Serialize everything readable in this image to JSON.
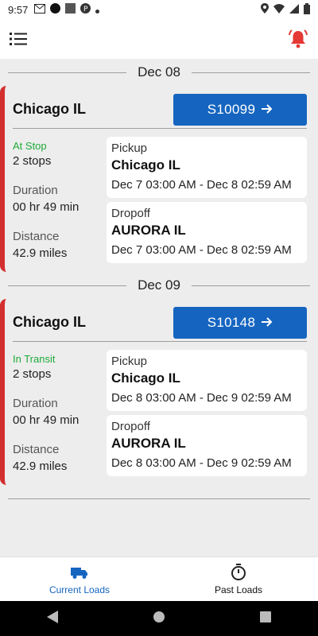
{
  "status_bar": {
    "time": "9:57"
  },
  "colors": {
    "accent": "#1565c0",
    "alert": "#d32f2f",
    "status_green": "#1faa3a"
  },
  "groups": [
    {
      "date": "Dec 08",
      "load": {
        "city": "Chicago IL",
        "load_id": "S10099",
        "status": "At Stop",
        "stops": "2 stops",
        "duration_label": "Duration",
        "duration": "00 hr 49 min",
        "distance_label": "Distance",
        "distance": "42.9 miles",
        "pickup": {
          "type": "Pickup",
          "city": "Chicago IL",
          "time": "Dec 7 03:00 AM - Dec 8 02:59 AM"
        },
        "dropoff": {
          "type": "Dropoff",
          "city": "AURORA IL",
          "time": "Dec 7 03:00 AM - Dec 8 02:59 AM"
        }
      }
    },
    {
      "date": "Dec 09",
      "load": {
        "city": "Chicago IL",
        "load_id": "S10148",
        "status": "In Transit",
        "stops": "2 stops",
        "duration_label": "Duration",
        "duration": "00 hr 49 min",
        "distance_label": "Distance",
        "distance": "42.9 miles",
        "pickup": {
          "type": "Pickup",
          "city": "Chicago IL",
          "time": "Dec 8 03:00 AM - Dec 9 02:59 AM"
        },
        "dropoff": {
          "type": "Dropoff",
          "city": "AURORA IL",
          "time": "Dec 8 03:00 AM - Dec 9 02:59 AM"
        }
      }
    }
  ],
  "bottom_nav": {
    "current_loads": "Current Loads",
    "past_loads": "Past Loads"
  }
}
